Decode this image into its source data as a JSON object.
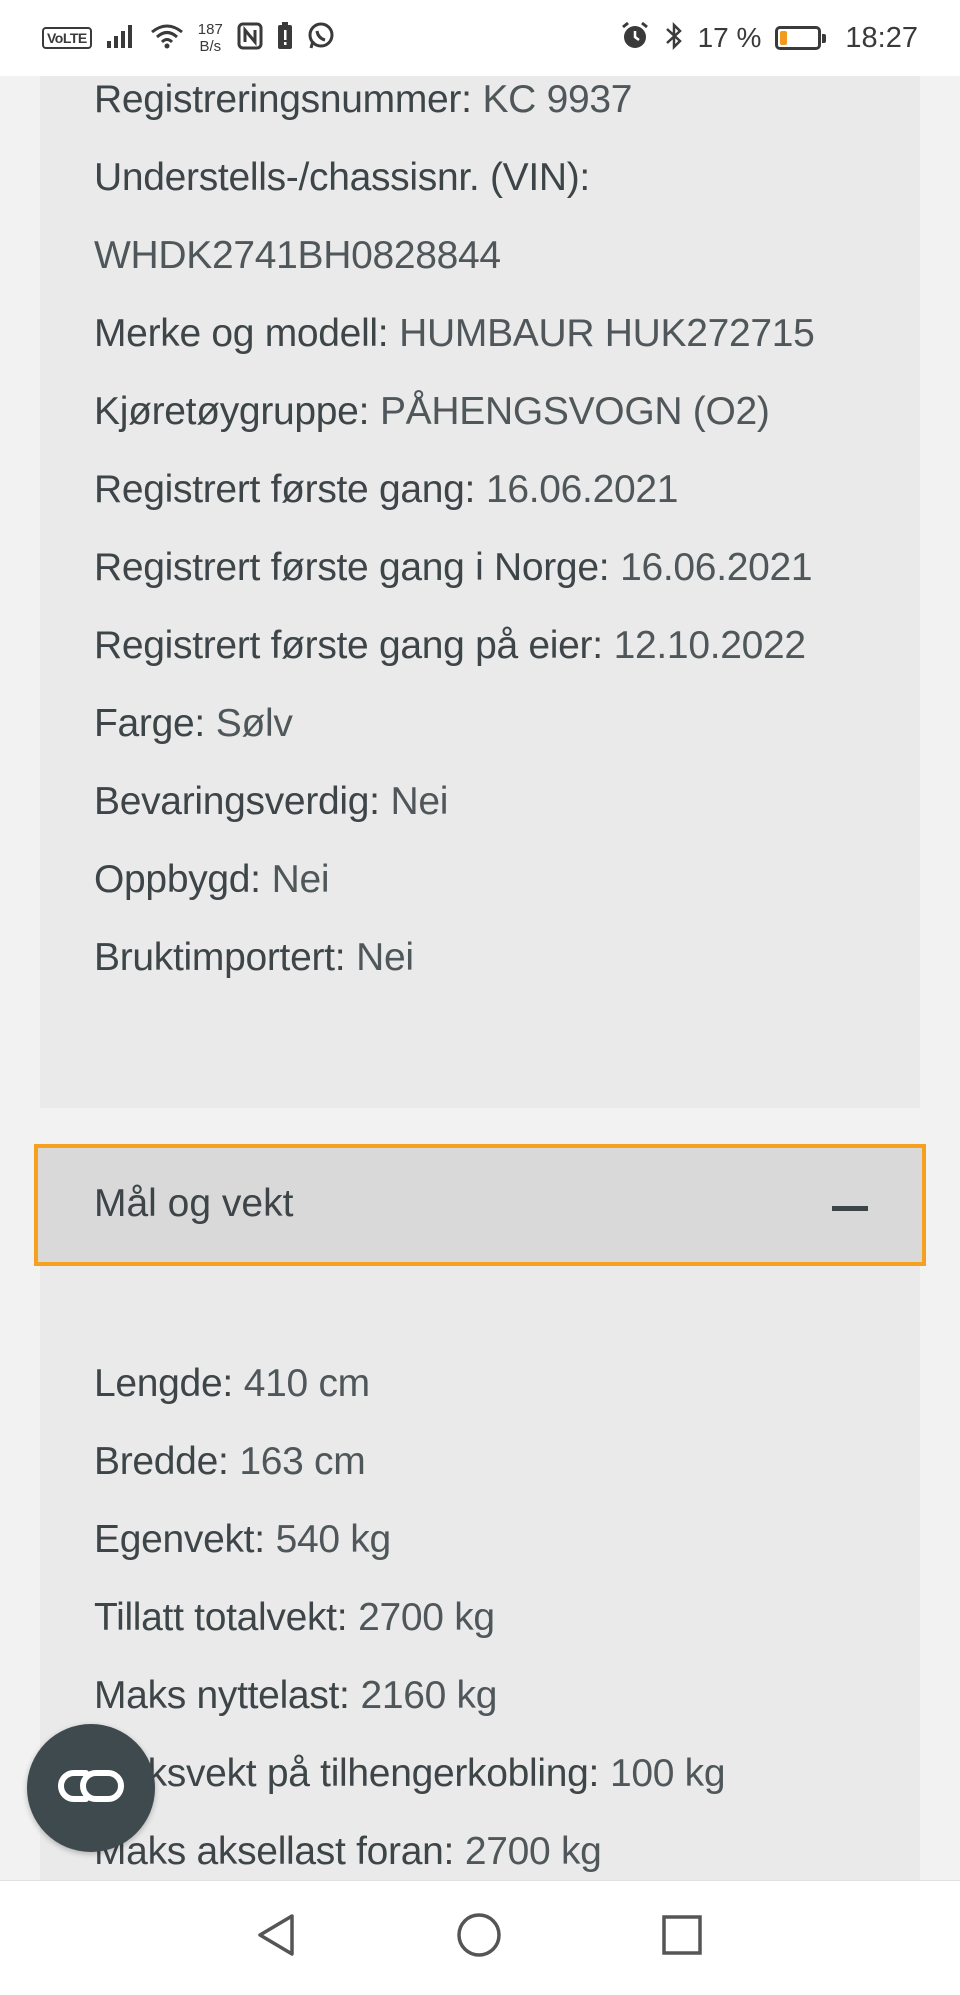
{
  "status_bar": {
    "volte": "VoLTE",
    "net_speed_value": "187",
    "net_speed_unit": "B/s",
    "battery_percent_text": "17 %",
    "battery_level": 0.17,
    "time": "18:27",
    "battery_color": "#f29a1b",
    "icons": [
      "signal-icon",
      "wifi-icon",
      "nfc-icon",
      "battery-alert-icon",
      "whatsapp-icon",
      "alarm-icon",
      "bluetooth-icon",
      "battery-icon"
    ]
  },
  "vehicle": {
    "rows": [
      {
        "key": "Registreringsnummer:",
        "value": "KC 9937"
      },
      {
        "key": "Understells-/chassisnr. (VIN):",
        "value": ""
      },
      {
        "key": "",
        "value": "WHDK2741BH0828844"
      },
      {
        "key": "Merke og modell:",
        "value": "HUMBAUR HUK272715"
      },
      {
        "key": "Kjøretøygruppe:",
        "value": "PÅHENGSVOGN (O2)"
      },
      {
        "key": "Registrert første gang:",
        "value": "16.06.2021"
      },
      {
        "key": "Registrert første gang i Norge:",
        "value": "16.06.2021"
      },
      {
        "key": "Registrert første gang på eier:",
        "value": "12.10.2022"
      },
      {
        "key": "Farge:",
        "value": "Sølv"
      },
      {
        "key": "Bevaringsverdig:",
        "value": "Nei"
      },
      {
        "key": "Oppbygd:",
        "value": "Nei"
      },
      {
        "key": "Bruktimportert:",
        "value": "Nei"
      }
    ]
  },
  "accordion": {
    "title": "Mål og vekt",
    "accent_color": "#f5a11f"
  },
  "dimensions": {
    "rows": [
      {
        "key": "Lengde:",
        "value": "410 cm"
      },
      {
        "key": "Bredde:",
        "value": "163 cm"
      },
      {
        "key": "Egenvekt:",
        "value": "540 kg"
      },
      {
        "key": "Tillatt totalvekt:",
        "value": "2700 kg"
      },
      {
        "key": "Maks nyttelast:",
        "value": "2160 kg"
      },
      {
        "key": "Maksvekt på tilhengerkobling:",
        "value": "100 kg"
      },
      {
        "key": "Maks aksellast foran:",
        "value": "2700 kg"
      }
    ]
  },
  "floating_button": {
    "icon": "co-link-icon"
  },
  "nav_bar": {
    "buttons": [
      "back-icon",
      "home-icon",
      "recents-icon"
    ]
  }
}
